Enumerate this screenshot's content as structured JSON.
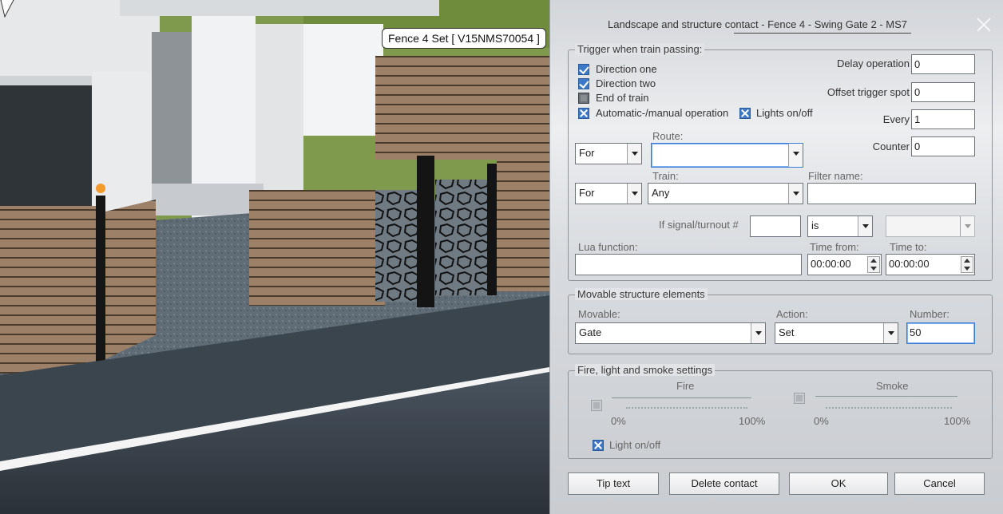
{
  "scene": {
    "tooltip": "Fence 4 Set [ V15NMS70054 ]"
  },
  "dialog": {
    "title": "Landscape and structure contact - Fence 4 - Swing Gate 2 - MS7",
    "trigger": {
      "group_title": "Trigger when train passing:",
      "direction_one": {
        "label": "Direction one",
        "checked": true
      },
      "direction_two": {
        "label": "Direction two",
        "checked": true
      },
      "end_of_train": {
        "label": "End of train",
        "checked": false
      },
      "auto_manual": {
        "label": "Automatic-/manual operation",
        "checked": true
      },
      "lights": {
        "label": "Lights on/off",
        "checked": true
      },
      "delay_label": "Delay operation",
      "delay_value": "0",
      "offset_label": "Offset trigger spot",
      "offset_value": "0",
      "every_label": "Every",
      "every_value": "1",
      "counter_label": "Counter",
      "counter_value": "0",
      "route_label": "Route:",
      "route_for": "For",
      "route_value": "",
      "train_label": "Train:",
      "train_for": "For",
      "train_value": "Any",
      "filter_label": "Filter name:",
      "filter_value": "",
      "signal_label": "If signal/turnout #",
      "signal_value": "",
      "is_value": "is",
      "state_value": "",
      "lua_label": "Lua function:",
      "lua_value": "",
      "time_from_label": "Time from:",
      "time_from_value": "00:00:00",
      "time_to_label": "Time to:",
      "time_to_value": "00:00:00"
    },
    "movable": {
      "group_title": "Movable structure elements",
      "movable_label": "Movable:",
      "movable_value": "Gate",
      "action_label": "Action:",
      "action_value": "Set",
      "number_label": "Number:",
      "number_value": "50"
    },
    "fire": {
      "group_title": "Fire, light and smoke settings",
      "fire_label": "Fire",
      "fire_min": "0%",
      "fire_max": "100%",
      "smoke_label": "Smoke",
      "smoke_min": "0%",
      "smoke_max": "100%",
      "light": {
        "label": "Light on/off",
        "checked": true
      }
    },
    "buttons": {
      "tip_text": "Tip text",
      "delete_contact": "Delete contact",
      "ok": "OK",
      "cancel": "Cancel"
    }
  }
}
